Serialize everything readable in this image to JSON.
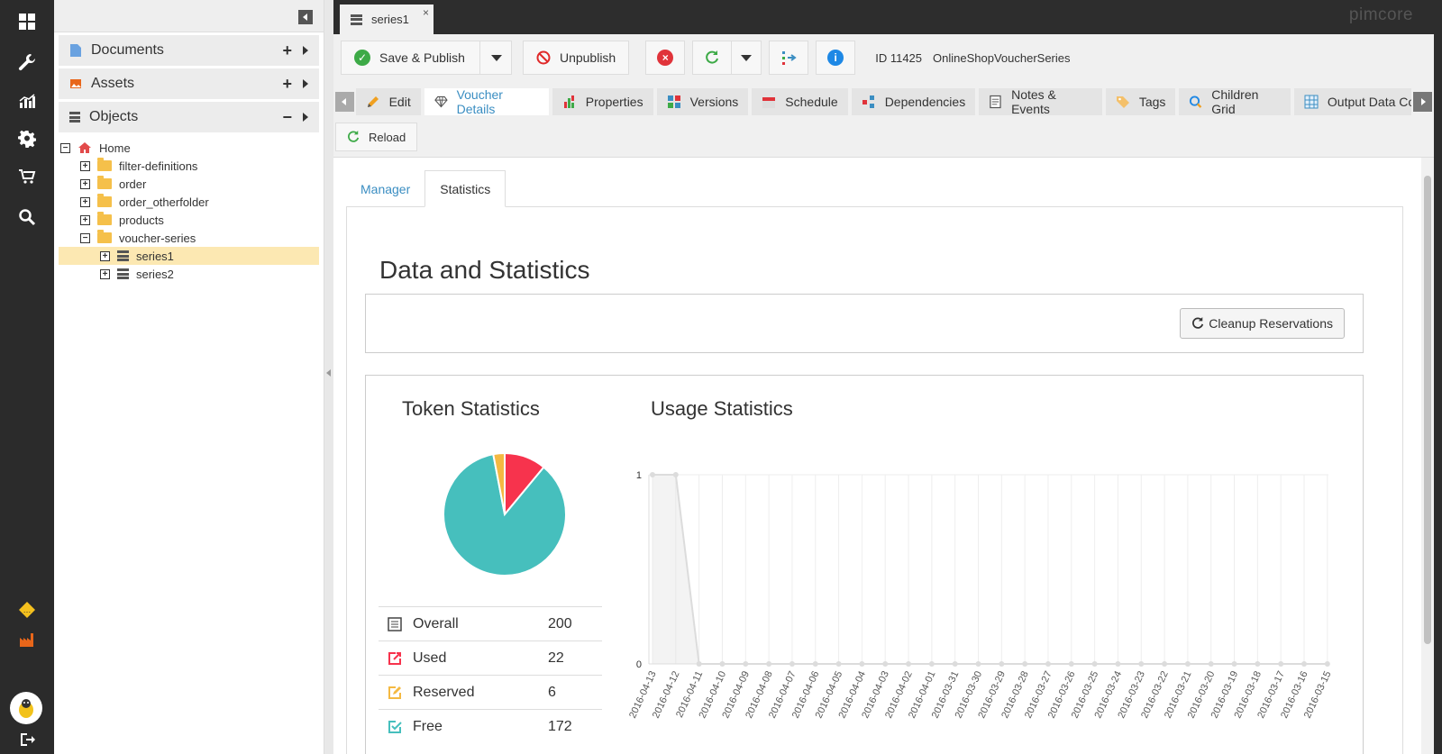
{
  "brand": "pimcore",
  "rail": {
    "icons": [
      "dashboard-icon",
      "wrench-icon",
      "chart-icon",
      "gear-icon",
      "cart-icon",
      "search-icon",
      "warning-icon",
      "factory-icon",
      "avatar",
      "logout-icon"
    ]
  },
  "tree": {
    "sections": [
      {
        "label": "Documents",
        "action": "+"
      },
      {
        "label": "Assets",
        "action": "+"
      },
      {
        "label": "Objects",
        "action": "−"
      }
    ],
    "nodes": [
      {
        "label": "Home",
        "toggle": "−",
        "depth": 0,
        "type": "home"
      },
      {
        "label": "filter-definitions",
        "toggle": "+",
        "depth": 1,
        "type": "folder"
      },
      {
        "label": "order",
        "toggle": "+",
        "depth": 1,
        "type": "folder"
      },
      {
        "label": "order_otherfolder",
        "toggle": "+",
        "depth": 1,
        "type": "folder"
      },
      {
        "label": "products",
        "toggle": "+",
        "depth": 1,
        "type": "folder"
      },
      {
        "label": "voucher-series",
        "toggle": "−",
        "depth": 1,
        "type": "folder"
      },
      {
        "label": "series1",
        "toggle": "+",
        "depth": 2,
        "type": "object",
        "selected": true
      },
      {
        "label": "series2",
        "toggle": "+",
        "depth": 2,
        "type": "object"
      }
    ]
  },
  "doc_tab": {
    "label": "series1",
    "close": "×"
  },
  "toolbar": {
    "save_publish": "Save & Publish",
    "unpublish": "Unpublish",
    "id_text": "ID 11425",
    "class_name": "OnlineShopVoucherSeries"
  },
  "tabs": [
    "Edit",
    "Voucher Details",
    "Properties",
    "Versions",
    "Schedule",
    "Dependencies",
    "Notes & Events",
    "Tags",
    "Children Grid",
    "Output Data Conf"
  ],
  "reload": "Reload",
  "subtabs": [
    "Manager",
    "Statistics"
  ],
  "stats": {
    "heading": "Data and Statistics",
    "cleanup": "Cleanup Reservations",
    "token_title": "Token Statistics",
    "usage_title": "Usage Statistics",
    "rows": [
      {
        "label": "Overall",
        "value": "200",
        "color": "#444444"
      },
      {
        "label": "Used",
        "value": "22",
        "color": "#f7334d"
      },
      {
        "label": "Reserved",
        "value": "6",
        "color": "#f4b942"
      },
      {
        "label": "Free",
        "value": "172",
        "color": "#46bfbd"
      }
    ]
  },
  "chart_data": [
    {
      "type": "pie",
      "title": "Token Statistics",
      "categories": [
        "Free",
        "Used",
        "Reserved"
      ],
      "values": [
        172,
        22,
        6
      ],
      "colors": [
        "#46bfbd",
        "#f7334d",
        "#f4b942"
      ]
    },
    {
      "type": "line",
      "title": "Usage Statistics",
      "x": [
        "2016-04-13",
        "2016-04-12",
        "2016-04-11",
        "2016-04-10",
        "2016-04-09",
        "2016-04-08",
        "2016-04-07",
        "2016-04-06",
        "2016-04-05",
        "2016-04-04",
        "2016-04-03",
        "2016-04-02",
        "2016-04-01",
        "2016-03-31",
        "2016-03-30",
        "2016-03-29",
        "2016-03-28",
        "2016-03-27",
        "2016-03-26",
        "2016-03-25",
        "2016-03-24",
        "2016-03-23",
        "2016-03-22",
        "2016-03-21",
        "2016-03-20",
        "2016-03-19",
        "2016-03-18",
        "2016-03-17",
        "2016-03-16",
        "2016-03-15"
      ],
      "values": [
        1,
        1,
        0,
        0,
        0,
        0,
        0,
        0,
        0,
        0,
        0,
        0,
        0,
        0,
        0,
        0,
        0,
        0,
        0,
        0,
        0,
        0,
        0,
        0,
        0,
        0,
        0,
        0,
        0,
        0
      ],
      "yticks": [
        "0",
        "1"
      ],
      "ylim": [
        0,
        1
      ],
      "grid": true
    }
  ]
}
